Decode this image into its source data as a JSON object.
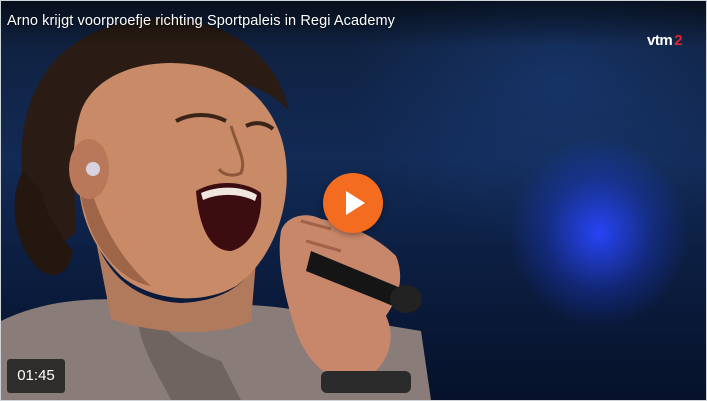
{
  "video": {
    "title": "Arno krijgt voorproefje richting Sportpaleis in Regi Academy",
    "duration": "01:45"
  },
  "channel_logo": {
    "text": "vtm",
    "number": "2",
    "number_color": "#e8212b"
  },
  "play_button": {
    "color": "#f36c20",
    "icon": "play-icon"
  }
}
